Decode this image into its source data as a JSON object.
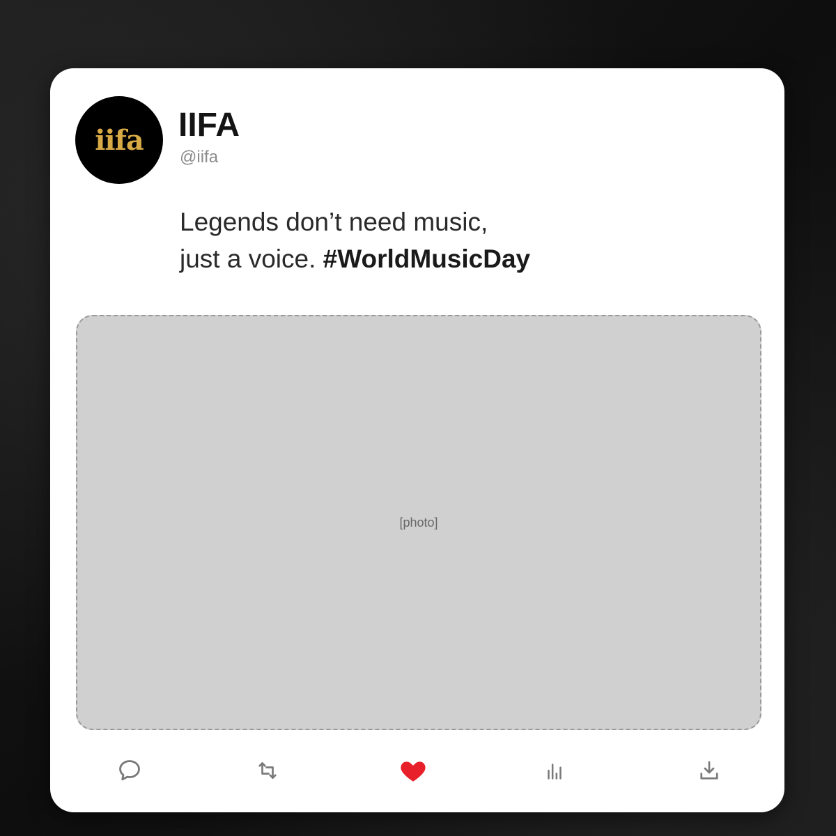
{
  "post": {
    "display_name": "IIFA",
    "handle": "@iifa",
    "avatar_text": "iifa",
    "text_line_1": "Legends don’t need music,",
    "text_line_2_prefix": "just a voice. ",
    "hashtag": "#WorldMusicDay",
    "media_description": "[photo]"
  },
  "actions": [
    {
      "name": "reply",
      "icon": "comment-icon"
    },
    {
      "name": "repost",
      "icon": "repost-icon"
    },
    {
      "name": "like",
      "icon": "heart-icon",
      "active": true
    },
    {
      "name": "views",
      "icon": "analytics-icon"
    },
    {
      "name": "share",
      "icon": "download-icon"
    }
  ],
  "colors": {
    "like_active": "#e8202a",
    "icon_gray": "#7a7a7a",
    "card_bg": "#ffffff",
    "page_bg": "#141414",
    "avatar_gold": "#d8aa45"
  }
}
